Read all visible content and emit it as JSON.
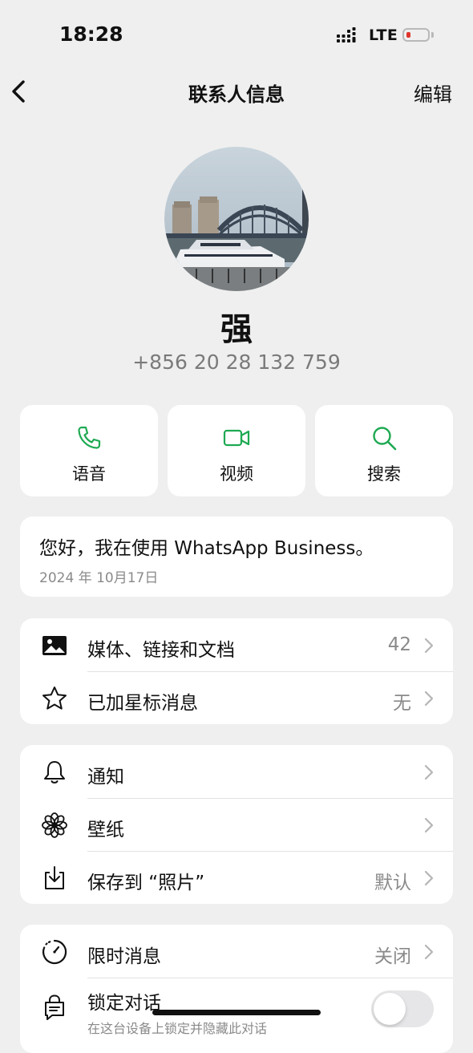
{
  "status_bar": {
    "time": "18:28",
    "network": "LTE",
    "battery_level": 0.1,
    "battery_color": "#e0342b"
  },
  "nav": {
    "back_icon": "chevron-left-icon",
    "title": "联系人信息",
    "edit_label": "编辑"
  },
  "contact": {
    "name": "强",
    "phone": "+856 20 28 132 759"
  },
  "actions": [
    {
      "label": "语音",
      "icon": "phone-icon"
    },
    {
      "label": "视频",
      "icon": "video-icon"
    },
    {
      "label": "搜索",
      "icon": "search-icon"
    }
  ],
  "about": {
    "text": "您好，我在使用 WhatsApp Business。",
    "date": "2024 年 10月17日"
  },
  "media_section": [
    {
      "label": "媒体、链接和文档",
      "value": "42",
      "icon": "photo-icon"
    },
    {
      "label": "已加星标消息",
      "value": "无",
      "icon": "star-icon"
    }
  ],
  "settings_section": [
    {
      "label": "通知",
      "value": "",
      "icon": "bell-icon"
    },
    {
      "label": "壁纸",
      "value": "",
      "icon": "flower-icon"
    },
    {
      "label": "保存到 “照片”",
      "value": "默认",
      "icon": "download-icon"
    }
  ],
  "privacy_section": {
    "disappearing": {
      "label": "限时消息",
      "value": "关闭",
      "icon": "timer-icon"
    },
    "lock_chat": {
      "label": "锁定对话",
      "subtitle": "在这台设备上锁定并隐藏此对话",
      "enabled": false,
      "icon": "lock-chat-icon"
    }
  },
  "colors": {
    "accent": "#1ea952",
    "background": "#efefef",
    "card": "#ffffff",
    "secondary_text": "#8a8a8a"
  }
}
